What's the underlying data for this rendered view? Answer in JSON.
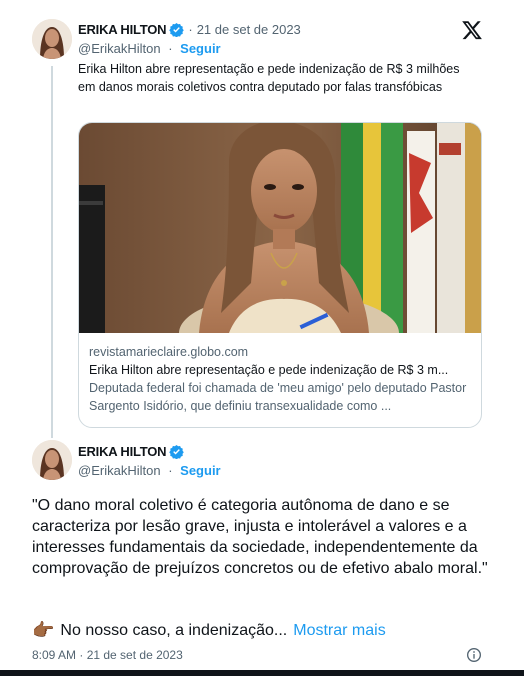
{
  "quoted_tweet": {
    "author_name": "ERIKA HILTON",
    "date": "21 de set de 2023",
    "handle": "@ErikakHilton",
    "follow_label": "Seguir",
    "text": "Erika Hilton abre representação e pede indenização de R$ 3 milhões em danos morais coletivos contra deputado por falas transfóbicas",
    "link_card": {
      "domain": "revistamarieclaire.globo.com",
      "title": "Erika Hilton abre representação e pede indenização de R$ 3 m...",
      "description": "Deputada federal foi chamada de 'meu amigo' pelo deputado Pastor Sargento Isidório, que definiu transexualidade como ..."
    }
  },
  "main_tweet": {
    "author_name": "ERIKA HILTON",
    "handle": "@ErikakHilton",
    "follow_label": "Seguir",
    "text": "\"O dano moral coletivo é categoria autônoma de dano e se caracteriza por lesão grave, injusta e intolerável a valores e a interesses fundamentais da sociedade, independentemente da comprovação de prejuízos concretos ou de efetivo abalo moral.\"",
    "continuation": "No nosso caso, a indenização...",
    "emoji": "👉🏾",
    "show_more_label": "Mostrar mais",
    "timestamp": "8:09 AM · 21 de set de 2023"
  },
  "icons": {
    "platform": "x-logo-icon",
    "verified": "verified-badge-icon",
    "info": "info-icon"
  },
  "colors": {
    "accent": "#1d9bf0",
    "text": "#0f1419",
    "muted": "#536471",
    "border": "#cfd9de"
  }
}
